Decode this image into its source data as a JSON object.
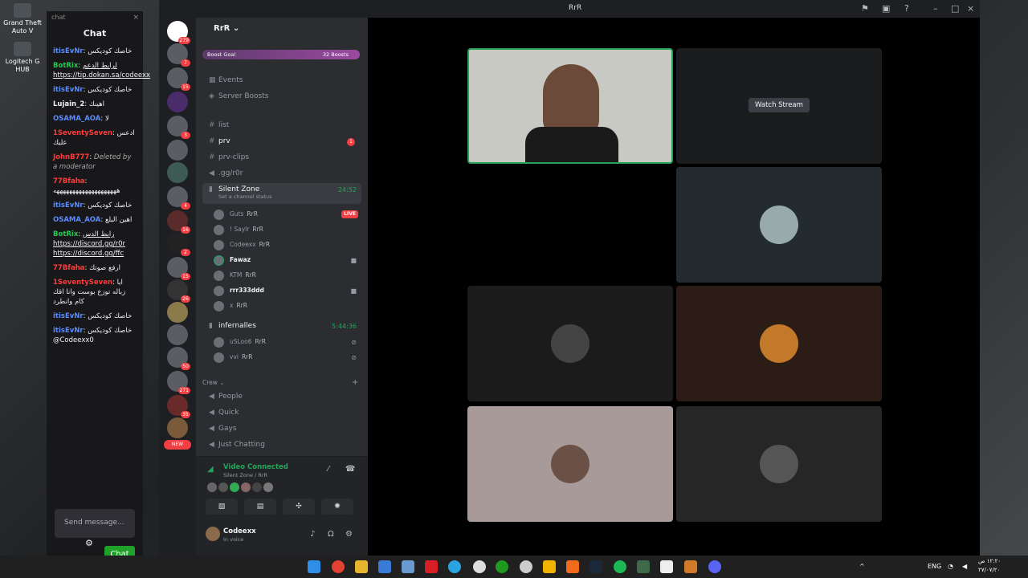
{
  "desktop": {
    "icons": [
      {
        "label": "Grand Theft Auto V"
      },
      {
        "label": "Logitech G HUB"
      }
    ]
  },
  "twitch_chat": {
    "window_title": "chat",
    "heading": "Chat",
    "messages": [
      {
        "user": "itisEvNr",
        "text": "خاصك كوديكس",
        "color": "blue"
      },
      {
        "user": "BotRix",
        "text": "لرابط الدعم https://tip.dokan.sa/codeexx",
        "color": "green"
      },
      {
        "user": "itisEvNr",
        "text": "خاصك كوديكس",
        "color": "blue"
      },
      {
        "user": "Lujain_2",
        "text": "اهينك",
        "color": "white"
      },
      {
        "user": "OSAMA_AOA",
        "text": "لا",
        "color": "blue"
      },
      {
        "user": "1SeventySeven",
        "text": "ادعس عليك",
        "color": "red"
      },
      {
        "user": "JohnB777",
        "text": "Deleted by a moderator",
        "color": "red"
      },
      {
        "user": "77Bfaha",
        "text": "ههههههههههههههههههههه",
        "color": "red"
      },
      {
        "user": "itisEvNr",
        "text": "خاصك كوديكس",
        "color": "blue"
      },
      {
        "user": "OSAMA_AOA",
        "text": "اهين البلع",
        "color": "blue"
      },
      {
        "user": "BotRix",
        "text": "رابط الدس https://discord.gg/r0r https://discord.gg/ffc",
        "color": "green"
      },
      {
        "user": "77Bfaha",
        "text": "ارفع صوتك",
        "color": "red"
      },
      {
        "user": "1SeventySeven",
        "text": "ايا زباله توزع بوست وانا اقك كام وانطرد",
        "color": "red"
      },
      {
        "user": "itisEvNr",
        "text": "خاصك كوديكس",
        "color": "blue"
      },
      {
        "user": "itisEvNr",
        "text": "خاصك كوديكس @Codeexx0",
        "color": "blue"
      }
    ],
    "send_placeholder": "Send message...",
    "chat_button": "Chat"
  },
  "discord": {
    "window_title": "RrR",
    "server_name": "RrR",
    "boost_goal": "Boost Goal",
    "boost_count": "32 Boosts",
    "guild_badges": [
      "279",
      "7",
      "15",
      "",
      "3",
      "",
      "",
      "4",
      "16",
      "2",
      "15",
      "26",
      "",
      "",
      "50",
      "271",
      "35",
      "",
      "NEW"
    ],
    "channels_top": [
      {
        "icon": "calendar",
        "label": "Events"
      },
      {
        "icon": "boost",
        "label": "Server Boosts"
      }
    ],
    "text_channels": [
      {
        "label": "list",
        "unread": false,
        "mentions": ""
      },
      {
        "label": "prv",
        "unread": true,
        "mentions": "1"
      },
      {
        "label": "prv-clips",
        "unread": false,
        "mentions": ""
      },
      {
        "label": ".gg/r0r",
        "unread": false,
        "mentions": ""
      }
    ],
    "voice_channel_1": {
      "name": "Silent Zone",
      "status": "Set a channel status",
      "timer": "24:52",
      "members": [
        {
          "name": "Guts",
          "tag": "RrR",
          "live": "LIVE"
        },
        {
          "name": "! Saylr",
          "tag": "RrR"
        },
        {
          "name": "Codeexx",
          "tag": "RrR"
        },
        {
          "name": "Fawaz",
          "tag": ""
        },
        {
          "name": "KTM",
          "tag": "RrR"
        },
        {
          "name": "rrr333ddd",
          "tag": ""
        },
        {
          "name": "x",
          "tag": "RrR"
        }
      ]
    },
    "voice_channel_2": {
      "name": "infernalles",
      "timer": "5:44:36",
      "members": [
        {
          "name": "uSLoo6",
          "tag": "RrR"
        },
        {
          "name": "vvi",
          "tag": "RrR"
        }
      ]
    },
    "category": "Crew",
    "crew_channels": [
      "People",
      "Quick",
      "Gays",
      "Just Chatting"
    ],
    "voice_status": "Video Connected",
    "voice_location": "Silent Zone / RrR",
    "user": {
      "name": "Codeexx",
      "status": "In voice"
    },
    "watch_stream": "Watch Stream"
  },
  "taskbar": {
    "lang": "ENG",
    "time": "١٢:٢٠ ص",
    "date": "٢٧/٠٧/٢٠"
  },
  "colors": {
    "accent_green": "#23a55a",
    "live_red": "#f23f43",
    "twitch_green": "#1fa12a"
  }
}
